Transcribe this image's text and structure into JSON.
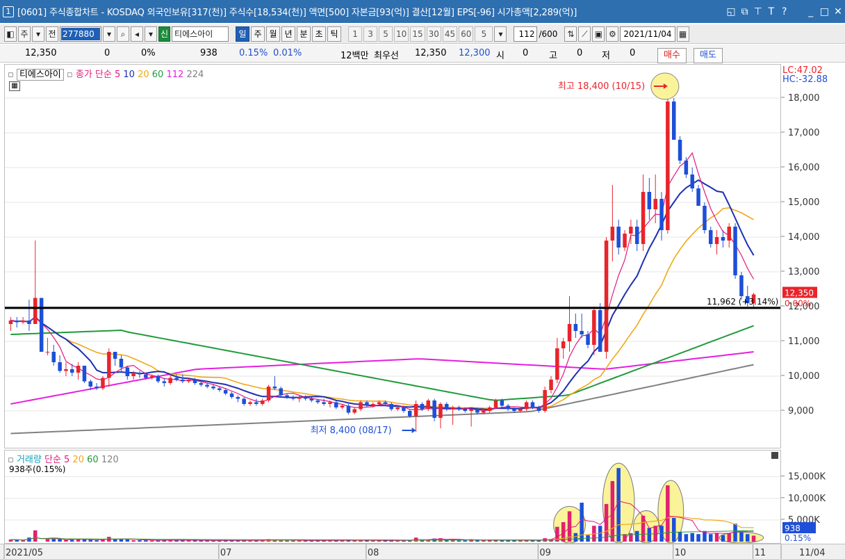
{
  "titlebar": {
    "window_number": "1",
    "title": "[0601] 주식종합차트 - KOSDAQ 외국인보유[317(천)] 주식수[18,534(천)] 액면[500] 자본금[93(억)] 결산[12월] EPS[-96] 시가총액[2,289(억)]",
    "icons": [
      "window-icon",
      "copy-window-icon",
      "pin-icon",
      "font-icon",
      "help-icon",
      "minimize-icon",
      "maximize-icon",
      "close-icon"
    ],
    "icon_glyphs": [
      "◱",
      "⧉",
      "⊤",
      "T",
      "?",
      "_",
      "□",
      "✕"
    ]
  },
  "toolbar": {
    "market": "주",
    "prev_label": "전",
    "code": "277880",
    "stock_name": "티에스아이",
    "new_label": "신",
    "periods": [
      "일",
      "주",
      "월",
      "년",
      "분",
      "초",
      "틱"
    ],
    "active_period": "일",
    "intervals": [
      "1",
      "3",
      "5",
      "10",
      "15",
      "30",
      "45",
      "60"
    ],
    "interval_select": "5",
    "count_value": "112",
    "count_total": "/600",
    "date": "2021/11/04"
  },
  "quote": {
    "price": "12,350",
    "change": "0",
    "change_pct": "0%",
    "volume": "938",
    "vol_pct": "0.15%",
    "turnover_pct": "0.01%",
    "amount": "12백만",
    "best_label": "최우선",
    "best_ask": "12,350",
    "best_bid": "12,300",
    "open_label": "시",
    "open_value": "0",
    "high_label": "고",
    "high_value": "0",
    "low_label": "저",
    "low_value": "0",
    "buy_label": "매수",
    "sell_label": "매도"
  },
  "price_legend": {
    "stock": "티에스아이",
    "close_label": "종가",
    "ma_type": "단순",
    "ma_periods": [
      "5",
      "10",
      "20",
      "60",
      "112",
      "224"
    ]
  },
  "volume_legend": {
    "title": "거래량",
    "ma_type": "단순",
    "ma_periods": [
      "5",
      "20",
      "60",
      "120"
    ],
    "current": "938주(0.15%)"
  },
  "axis": {
    "lc": "LC:47.02",
    "hc": "HC:-32.88",
    "price_ticks": [
      "18,000",
      "17,000",
      "16,000",
      "15,000",
      "14,000",
      "13,000",
      "12,000",
      "11,000",
      "10,000",
      "9,000"
    ],
    "current_price": "12,350",
    "current_pct": "0.00%",
    "volume_ticks": [
      "15,000K",
      "10,000K",
      "5,000K"
    ],
    "current_volume": "938",
    "current_volume_pct": "0.15%",
    "date_ticks": [
      "2021/05",
      "07",
      "08",
      "09",
      "10",
      "11"
    ],
    "end_date": "11/04"
  },
  "annotations": {
    "high": "최고 18,400 (10/15)",
    "low": "최저 8,400 (08/17)",
    "ref_line": "11,962 (+3.14%)"
  },
  "colors": {
    "up": "#e8242b",
    "down": "#1d4fd8",
    "ma5": "#e2187c",
    "ma10": "#1d2fb0",
    "ma20": "#f0a818",
    "ma60": "#1f9a3a",
    "ma112": "#e41ee0",
    "ma224": "#808080",
    "title_bar": "#2e6fb0"
  },
  "chart_data": {
    "type": "candlestick",
    "title": "티에스아이",
    "y_range": [
      8000,
      18500
    ],
    "dates": [
      "2021/05",
      "07",
      "08",
      "09",
      "10",
      "11"
    ],
    "ohlc": [
      [
        11500,
        11700,
        11300,
        11600
      ],
      [
        11600,
        11700,
        11400,
        11550
      ],
      [
        11550,
        11700,
        11500,
        11600
      ],
      [
        11600,
        12200,
        11300,
        11500
      ],
      [
        11500,
        13900,
        11700,
        12250
      ],
      [
        12250,
        11000,
        11800,
        10700
      ],
      [
        10700,
        11100,
        10600,
        10700
      ],
      [
        10700,
        10900,
        10300,
        10400
      ],
      [
        10400,
        10600,
        10100,
        10150
      ],
      [
        10150,
        10400,
        10000,
        10200
      ],
      [
        10200,
        10350,
        10000,
        10100
      ],
      [
        10100,
        10400,
        9900,
        10300
      ],
      [
        10300,
        10300,
        9800,
        9850
      ],
      [
        9850,
        9900,
        9600,
        9700
      ],
      [
        9700,
        9800,
        9600,
        9650
      ],
      [
        9650,
        10000,
        9600,
        9950
      ],
      [
        9950,
        10800,
        9700,
        10700
      ],
      [
        10700,
        10700,
        10300,
        10500
      ],
      [
        10500,
        10600,
        10100,
        10250
      ],
      [
        10250,
        10300,
        9900,
        10000
      ],
      [
        10000,
        10150,
        9900,
        10100
      ],
      [
        10100,
        10150,
        9950,
        10050
      ],
      [
        10050,
        10100,
        9900,
        9950
      ],
      [
        9950,
        10050,
        9900,
        10000
      ],
      [
        10000,
        10050,
        9800,
        9850
      ],
      [
        9850,
        9950,
        9700,
        9800
      ],
      [
        9800,
        10050,
        9750,
        9950
      ],
      [
        9950,
        10050,
        9850,
        9900
      ],
      [
        9900,
        10050,
        9800,
        9850
      ],
      [
        9850,
        9950,
        9800,
        9900
      ],
      [
        9900,
        9950,
        9750,
        9800
      ],
      [
        9800,
        9850,
        9700,
        9750
      ],
      [
        9750,
        9800,
        9650,
        9700
      ],
      [
        9700,
        9750,
        9600,
        9650
      ],
      [
        9650,
        9700,
        9550,
        9600
      ],
      [
        9600,
        9650,
        9450,
        9500
      ],
      [
        9500,
        9550,
        9350,
        9400
      ],
      [
        9400,
        9450,
        9250,
        9350
      ],
      [
        9350,
        9400,
        9150,
        9200
      ],
      [
        9200,
        9300,
        9150,
        9250
      ],
      [
        9250,
        9350,
        9150,
        9200
      ],
      [
        9200,
        9350,
        9150,
        9300
      ],
      [
        9300,
        9750,
        9250,
        9700
      ],
      [
        9700,
        10000,
        9600,
        9650
      ],
      [
        9650,
        9700,
        9400,
        9450
      ],
      [
        9450,
        9500,
        9350,
        9400
      ],
      [
        9400,
        9450,
        9300,
        9350
      ],
      [
        9350,
        9450,
        9250,
        9400
      ],
      [
        9400,
        9450,
        9300,
        9350
      ],
      [
        9350,
        9400,
        9250,
        9300
      ],
      [
        9300,
        9350,
        9200,
        9250
      ],
      [
        9250,
        9350,
        9150,
        9200
      ],
      [
        9200,
        9300,
        9100,
        9250
      ],
      [
        9250,
        9300,
        9050,
        9100
      ],
      [
        9100,
        9200,
        9050,
        9150
      ],
      [
        9150,
        9200,
        8900,
        8950
      ],
      [
        8950,
        9100,
        8900,
        9050
      ],
      [
        9050,
        9300,
        9000,
        9250
      ],
      [
        9250,
        9300,
        9100,
        9150
      ],
      [
        9150,
        9250,
        9100,
        9200
      ],
      [
        9200,
        9300,
        9150,
        9250
      ],
      [
        9250,
        9300,
        9150,
        9200
      ],
      [
        9200,
        9250,
        9000,
        9050
      ],
      [
        9050,
        9150,
        9000,
        9100
      ],
      [
        9100,
        9150,
        8950,
        9000
      ],
      [
        9000,
        9050,
        8800,
        8850
      ],
      [
        8850,
        9300,
        8400,
        9200
      ],
      [
        9200,
        9250,
        9000,
        9050
      ],
      [
        9050,
        9350,
        9000,
        9300
      ],
      [
        9300,
        9350,
        8700,
        8800
      ],
      [
        8800,
        9250,
        8500,
        9200
      ],
      [
        9200,
        9250,
        9000,
        9050
      ],
      [
        9050,
        9150,
        8600,
        9100
      ],
      [
        9100,
        9150,
        9000,
        9050
      ],
      [
        9050,
        9100,
        8950,
        9000
      ],
      [
        9000,
        9050,
        8550,
        9050
      ],
      [
        9050,
        9100,
        8900,
        8950
      ],
      [
        8950,
        9050,
        8900,
        9000
      ],
      [
        9000,
        9150,
        8950,
        9100
      ],
      [
        9100,
        9350,
        9050,
        9300
      ],
      [
        9300,
        9350,
        9100,
        9150
      ],
      [
        9150,
        9200,
        9000,
        9050
      ],
      [
        9050,
        9100,
        8950,
        9000
      ],
      [
        9000,
        9100,
        8950,
        9050
      ],
      [
        9050,
        9300,
        9000,
        9250
      ],
      [
        9250,
        9300,
        9050,
        9100
      ],
      [
        9100,
        9150,
        8950,
        9000
      ],
      [
        9000,
        9700,
        8950,
        9600
      ],
      [
        9600,
        10000,
        9500,
        9900
      ],
      [
        9900,
        11100,
        9800,
        10800
      ],
      [
        10800,
        11100,
        10500,
        11000
      ],
      [
        11000,
        12300,
        10700,
        11500
      ],
      [
        11500,
        11800,
        11100,
        11300
      ],
      [
        11300,
        11800,
        11100,
        11200
      ],
      [
        11200,
        11300,
        10800,
        10900
      ],
      [
        10900,
        12000,
        10600,
        11900
      ],
      [
        11900,
        12100,
        10700,
        10700
      ],
      [
        10700,
        14000,
        10500,
        13900
      ],
      [
        13900,
        15500,
        13300,
        14300
      ],
      [
        14300,
        14500,
        13500,
        13700
      ],
      [
        13700,
        14200,
        13600,
        14100
      ],
      [
        14100,
        14500,
        13800,
        14300
      ],
      [
        14300,
        14500,
        13600,
        13800
      ],
      [
        13800,
        15800,
        13600,
        15300
      ],
      [
        15300,
        15700,
        14500,
        14800
      ],
      [
        14800,
        15800,
        14400,
        15100
      ],
      [
        15100,
        15300,
        13900,
        14200
      ],
      [
        14200,
        18400,
        14100,
        17900
      ],
      [
        17900,
        18000,
        16800,
        16800
      ],
      [
        16800,
        16900,
        16100,
        16200
      ],
      [
        16200,
        16300,
        15700,
        15800
      ],
      [
        15800,
        16000,
        15300,
        15400
      ],
      [
        15400,
        15500,
        14900,
        14900
      ],
      [
        14900,
        15000,
        14100,
        14200
      ],
      [
        14200,
        14300,
        13700,
        13800
      ],
      [
        13800,
        14200,
        13500,
        14000
      ],
      [
        14000,
        14200,
        13700,
        13900
      ],
      [
        13900,
        14400,
        13700,
        14300
      ],
      [
        14300,
        14400,
        12800,
        12900
      ],
      [
        12900,
        13000,
        12200,
        12300
      ],
      [
        12300,
        12600,
        12000,
        12100
      ],
      [
        12100,
        12400,
        11950,
        12350
      ]
    ],
    "volume_range": [
      0,
      18000000
    ]
  }
}
